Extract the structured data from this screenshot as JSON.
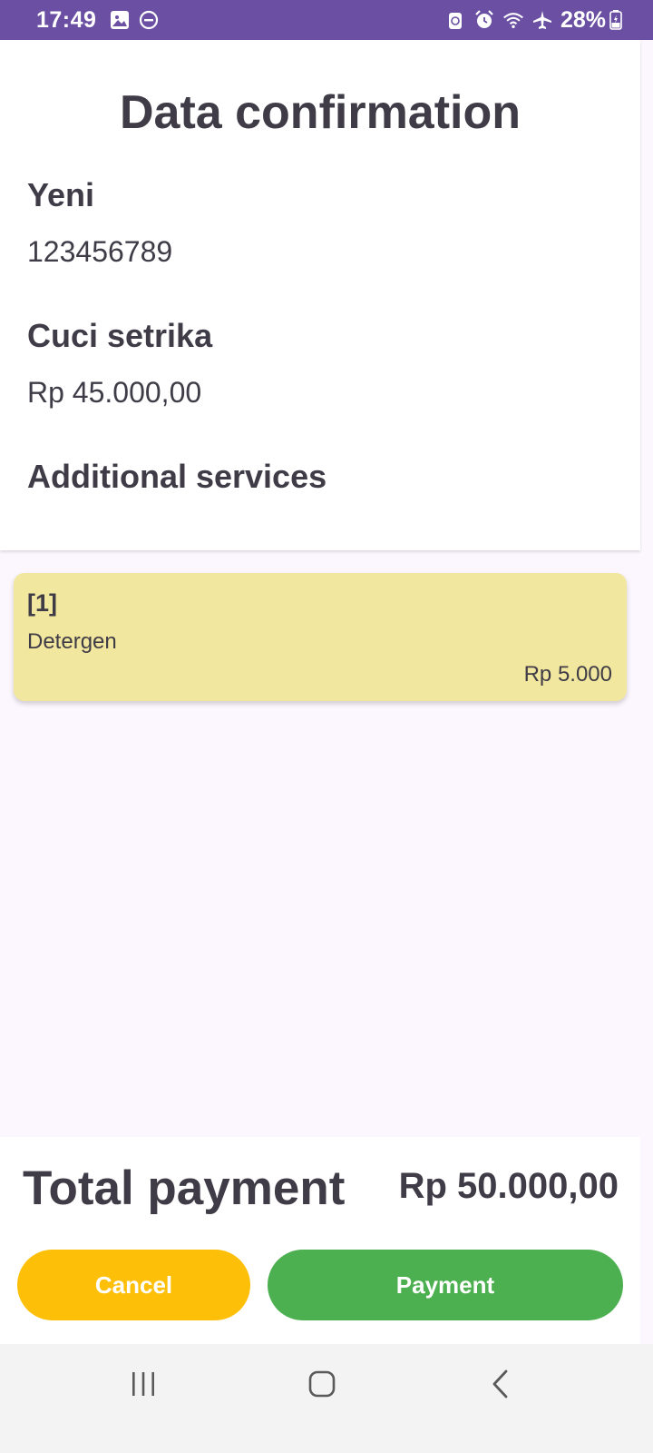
{
  "status_bar": {
    "time": "17:49",
    "battery": "28%",
    "left_icons": [
      "image-icon",
      "do-not-disturb-icon"
    ],
    "right_icons": [
      "data-saver-icon",
      "alarm-icon",
      "wifi-icon",
      "airplane-icon",
      "battery-icon"
    ]
  },
  "confirmation": {
    "title": "Data confirmation",
    "customer_name": "Yeni",
    "customer_phone": "123456789",
    "service_name": "Cuci setrika",
    "service_price": "Rp 45.000,00",
    "additional_title": "Additional services"
  },
  "additional_services": [
    {
      "index": "[1]",
      "name": "Detergen",
      "price": "Rp 5.000"
    }
  ],
  "total": {
    "label": "Total payment",
    "value": "Rp 50.000,00"
  },
  "actions": {
    "cancel_label": "Cancel",
    "payment_label": "Payment"
  },
  "nav_bar": {
    "buttons": [
      "recents-icon",
      "home-icon",
      "back-icon"
    ]
  },
  "colors": {
    "status_bar": "#6a4fa3",
    "card_highlight": "#f2e79e",
    "cancel_button": "#fdbf08",
    "payment_button": "#4caf50",
    "page_background": "#fcf7fe",
    "text": "#3f3c47"
  }
}
